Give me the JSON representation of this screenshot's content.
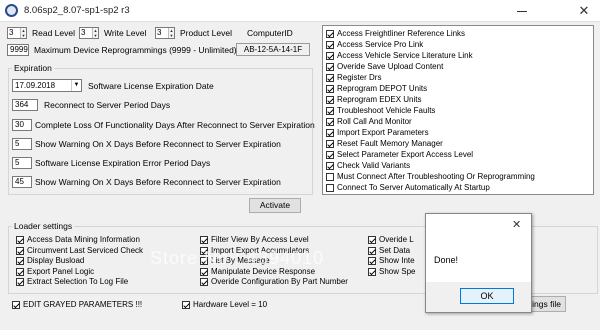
{
  "window": {
    "title": "8.06sp2_8.07-sp1-sp2 r3",
    "close_glyph": "✕",
    "min_label": ""
  },
  "top": {
    "read_level": {
      "value": "3",
      "label": "Read Level"
    },
    "write_level": {
      "value": "3",
      "label": "Write Level"
    },
    "product_level": {
      "value": "3",
      "label": "Product Level"
    },
    "computer_id": {
      "label": "ComputerID",
      "value": "AB-12-5A-14-1F"
    },
    "max_repro": {
      "value": "9999",
      "label": "Maximum Device Reprogrammings (9999 - Unlimited)"
    }
  },
  "expiration": {
    "legend": "Expiration",
    "date": {
      "value": "17.09.2018",
      "label": "Software License Expiration Date"
    },
    "rows": [
      {
        "value": "364",
        "label": "Reconnect to Server Period Days"
      },
      {
        "value": "30",
        "label": "Complete Loss Of Functionality Days After Reconnect to Server Expiration"
      },
      {
        "value": "5",
        "label": "Show Warning On X Days Before Reconnect to Server Expiration"
      },
      {
        "value": "5",
        "label": "Software License Expiration Error Period Days"
      },
      {
        "value": "45",
        "label": "Show Warning On X Days Before Reconnect to Server Expiration"
      }
    ]
  },
  "activate_button": "Activate",
  "features": [
    {
      "label": "Access Freightliner Reference Links",
      "checked": true
    },
    {
      "label": "Access Service Pro Link",
      "checked": true
    },
    {
      "label": "Access Vehicle Service Literature Link",
      "checked": true
    },
    {
      "label": "Overide Save Upload Content",
      "checked": true
    },
    {
      "label": "Register Drs",
      "checked": true
    },
    {
      "label": "Reprogram DEPOT Units",
      "checked": true
    },
    {
      "label": "Reprogram EDEX Units",
      "checked": true
    },
    {
      "label": "Troubleshoot Vehicle Faults",
      "checked": true
    },
    {
      "label": "Roll Call And Monitor",
      "checked": true
    },
    {
      "label": "Import Export Parameters",
      "checked": true
    },
    {
      "label": "Reset Fault Memory Manager",
      "checked": true
    },
    {
      "label": "Select Parameter Export Access Level",
      "checked": true
    },
    {
      "label": "Check Valid Variants",
      "checked": true
    },
    {
      "label": "Must Connect After Troubleshooting Or Reprogramming",
      "checked": false
    },
    {
      "label": "Connect To Server Automatically At Startup",
      "checked": false
    }
  ],
  "loader": {
    "legend": "Loader settings",
    "col1": [
      {
        "label": "Access Data Mining Information",
        "checked": true
      },
      {
        "label": "Circumvent Last Serviced Check",
        "checked": true
      },
      {
        "label": "Display Busload",
        "checked": true
      },
      {
        "label": "Export Panel Logic",
        "checked": true
      },
      {
        "label": "Extract Selection To Log File",
        "checked": true
      }
    ],
    "col2": [
      {
        "label": "Filter View By Access Level",
        "checked": true
      },
      {
        "label": "Import Export Accumulators",
        "checked": true
      },
      {
        "label": "List By Message",
        "checked": true
      },
      {
        "label": "Manipulate Device Response",
        "checked": true
      },
      {
        "label": "Overide Configuration By Part Number",
        "checked": true
      }
    ],
    "col3": [
      {
        "label": "Overide L",
        "checked": true
      },
      {
        "label": "Set Data",
        "checked": true
      },
      {
        "label": "Show Inte",
        "checked": true
      },
      {
        "label": "Show Spe",
        "checked": true
      }
    ]
  },
  "bottom": {
    "edit_grayed": {
      "label": "EDIT GRAYED PARAMETERS !!!",
      "checked": true
    },
    "hardware_level": {
      "label": "Hardware Level = 10",
      "checked": true
    },
    "settings_file_button": "ings file"
  },
  "dialog": {
    "close_glyph": "✕",
    "message": "Done!",
    "ok_label": "OK"
  },
  "watermark": "Store No.: 4394010"
}
